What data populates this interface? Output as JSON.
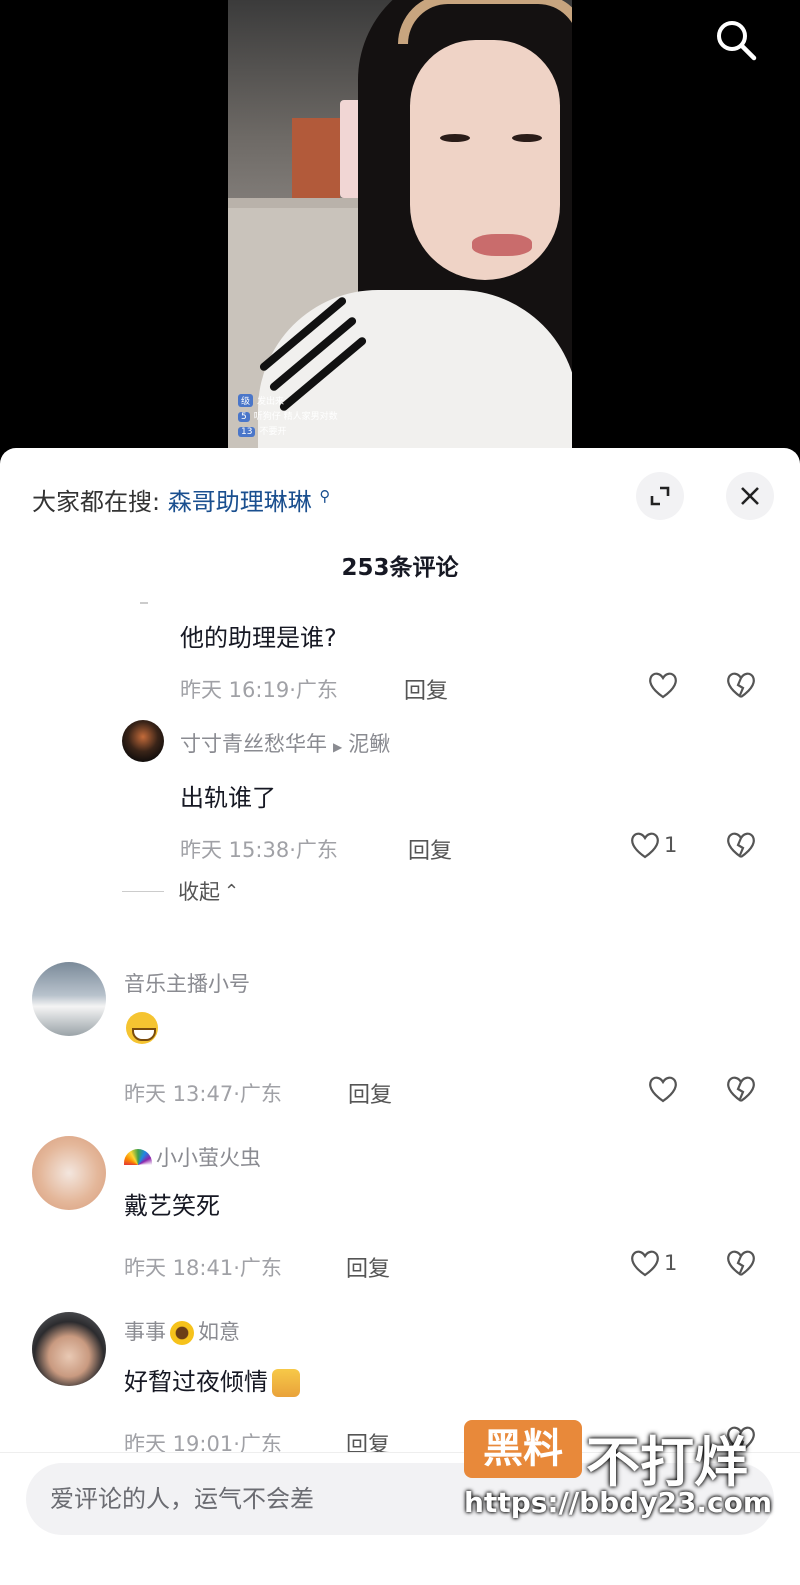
{
  "video": {
    "live_chat": [
      {
        "badge": "级",
        "text": "发出来"
      },
      {
        "badge": "5",
        "text": "听狗仔 精人家男对数"
      },
      {
        "badge": "13",
        "text": "不要开"
      }
    ]
  },
  "panel": {
    "search_prefix": "大家都在搜:",
    "search_keyword": "森哥助理琳琳",
    "comment_count": "253条评论",
    "collapse_label": "收起",
    "input_placeholder": "爱评论的人，运气不会差"
  },
  "comments": [
    {
      "text": "他的助理是谁?",
      "meta": "昨天 16:19·广东",
      "reply": "回复",
      "likes": ""
    },
    {
      "user": "寸寸青丝愁华年",
      "reply_to": "泥鳅",
      "text": "出轨谁了",
      "meta": "昨天 15:38·广东",
      "reply": "回复",
      "likes": "1"
    },
    {
      "user": "音乐主播小号",
      "meta": "昨天 13:47·广东",
      "reply": "回复",
      "likes": ""
    },
    {
      "user": "小小萤火虫",
      "text": "戴艺笑死",
      "meta": "昨天 18:41·广东",
      "reply": "回复",
      "likes": "1"
    },
    {
      "user": "事事",
      "user2": "如意",
      "text": "好睝过夜倾情",
      "meta": "昨天 19:01·广东",
      "reply": "回复",
      "likes": ""
    }
  ],
  "watermark": {
    "badge": "黑料",
    "title": "不打烊",
    "url": "https://bbdy23.com"
  }
}
